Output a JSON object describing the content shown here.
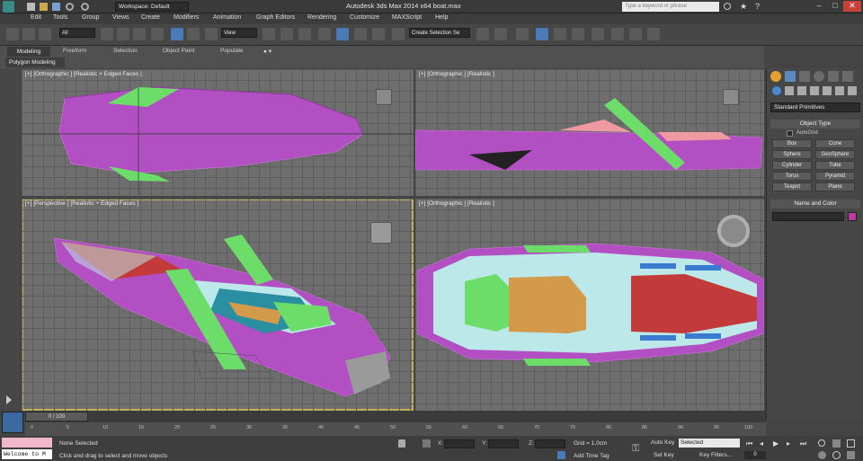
{
  "window": {
    "title": "Autodesk 3ds Max  2014 x64     boat.max",
    "workspace_label": "Workspace: Default",
    "search_placeholder": "Type a keyword or phrase"
  },
  "menu": [
    "Edit",
    "Tools",
    "Group",
    "Views",
    "Create",
    "Modifiers",
    "Animation",
    "Graph Editors",
    "Rendering",
    "Customize",
    "MAXScript",
    "Help"
  ],
  "toolbar": {
    "selection_filter": "All",
    "reference_coord": "View",
    "named_selection": "Create Selection Se"
  },
  "ribbon": {
    "tabs": [
      "Modeling",
      "Freeform",
      "Selection",
      "Object Paint",
      "Populate"
    ],
    "active_tab": "Modeling",
    "sub_label": "Polygon Modeling"
  },
  "viewports": {
    "top": "[+] [Orthographic ] [Realistic + Edged Faces ]",
    "front": "[+] [Orthographic ] [Realistic ]",
    "perspective": "[+] [Perspective ] [Realistic + Edged Faces ]",
    "left": "[+] [Orthographic ] [Realistic ]"
  },
  "command_panel": {
    "category": "Standard Primitives",
    "object_type_title": "Object Type",
    "autogrid": "AutoGrid",
    "buttons": [
      "Box",
      "Cone",
      "Sphere",
      "GeoSphere",
      "Cylinder",
      "Tube",
      "Torus",
      "Pyramid",
      "Teapot",
      "Plane"
    ],
    "name_color_title": "Name and Color",
    "object_color": "#c03a9e"
  },
  "timeline": {
    "frame_readout": "0 / 100",
    "ticks": [
      "0",
      "5",
      "10",
      "15",
      "20",
      "25",
      "30",
      "35",
      "40",
      "45",
      "50",
      "55",
      "60",
      "65",
      "70",
      "75",
      "80",
      "85",
      "90",
      "95",
      "100"
    ]
  },
  "status": {
    "maxscript": "Welcome to M",
    "selection": "None Selected",
    "prompt": "Click and drag to select and move objects",
    "x_label": "X:",
    "y_label": "Y:",
    "z_label": "Z:",
    "grid": "Grid = 1,0cm",
    "add_time_tag": "Add Time Tag",
    "auto_key": "Auto Key",
    "set_key": "Set Key",
    "key_mode": "Selected",
    "key_filters": "Key Filters...",
    "frame": "0"
  }
}
